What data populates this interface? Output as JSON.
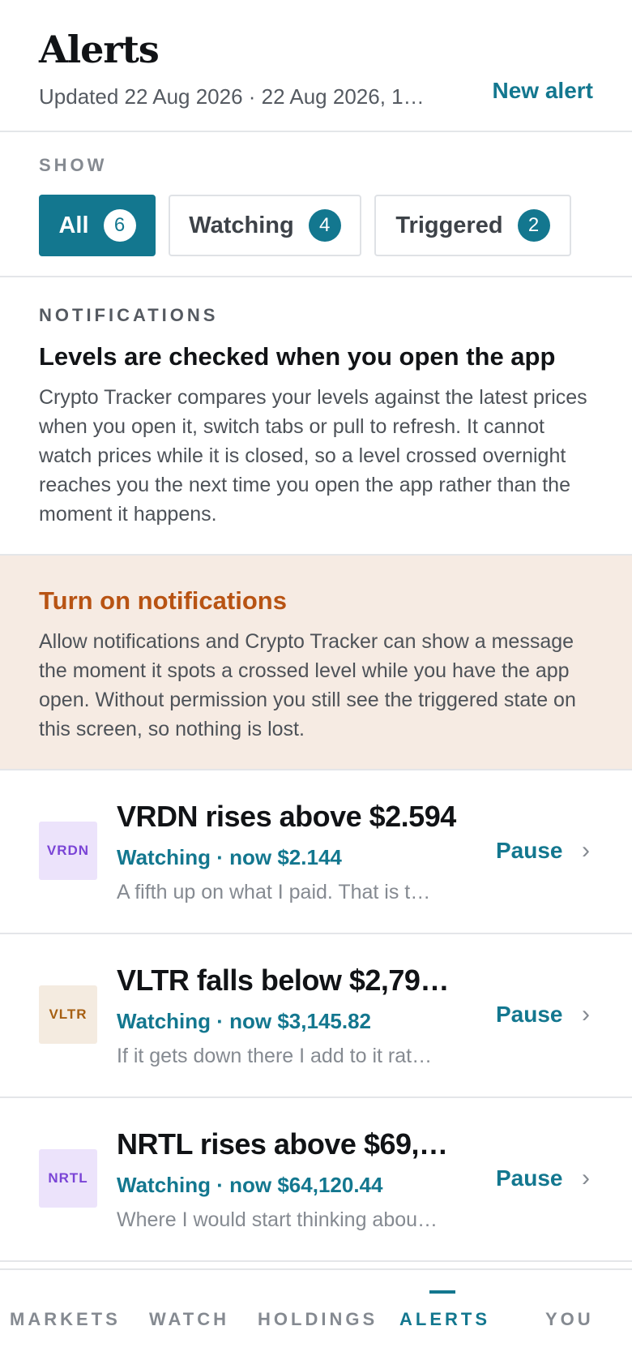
{
  "header": {
    "title": "Alerts",
    "updated": "Updated 22 Aug 2026 · 22 Aug 2026, 1…",
    "new_alert_label": "New alert"
  },
  "filters": {
    "label": "SHOW",
    "chips": [
      {
        "label": "All",
        "count": "6",
        "selected": true
      },
      {
        "label": "Watching",
        "count": "4",
        "selected": false
      },
      {
        "label": "Triggered",
        "count": "2",
        "selected": false
      }
    ]
  },
  "notifications": {
    "section_label": "NOTIFICATIONS",
    "title": "Levels are checked when you open the app",
    "body": "Crypto Tracker compares your levels against the latest prices when you open it, switch tabs or pull to refresh. It cannot watch prices while it is closed, so a level crossed overnight reaches you the next time you open the app rather than the moment it happens."
  },
  "permission": {
    "title": "Turn on notifications",
    "body": "Allow notifications and Crypto Tracker can show a message the moment it spots a crossed level while you have the app open. Without permission you still see the triggered state on this screen, so nothing is lost."
  },
  "alerts": [
    {
      "symbol": "VRDN",
      "title": "VRDN rises above $2.594",
      "status": "Watching · now $2.144",
      "note": "A fifth up on what I paid. That is t…",
      "action": "Pause",
      "logo_bg": "#ece3fb",
      "logo_fg": "#7a44d6"
    },
    {
      "symbol": "VLTR",
      "title": "VLTR falls below $2,79…",
      "status": "Watching · now $3,145.82",
      "note": "If it gets down there I add to it rat…",
      "action": "Pause",
      "logo_bg": "#f4ebe0",
      "logo_fg": "#a65f12"
    },
    {
      "symbol": "NRTL",
      "title": "NRTL rises above $69,8…",
      "status": "Watching · now $64,120.44",
      "note": "Where I would start thinking abou…",
      "action": "Pause",
      "logo_bg": "#ece3fb",
      "logo_fg": "#7a44d6"
    }
  ],
  "tabbar": {
    "tabs": [
      "MARKETS",
      "WATCH",
      "HOLDINGS",
      "ALERTS",
      "YOU"
    ],
    "active": "ALERTS"
  },
  "colors": {
    "accent": "#13778f",
    "warning": "#b85313",
    "warning_bg": "#f6ebe3"
  }
}
